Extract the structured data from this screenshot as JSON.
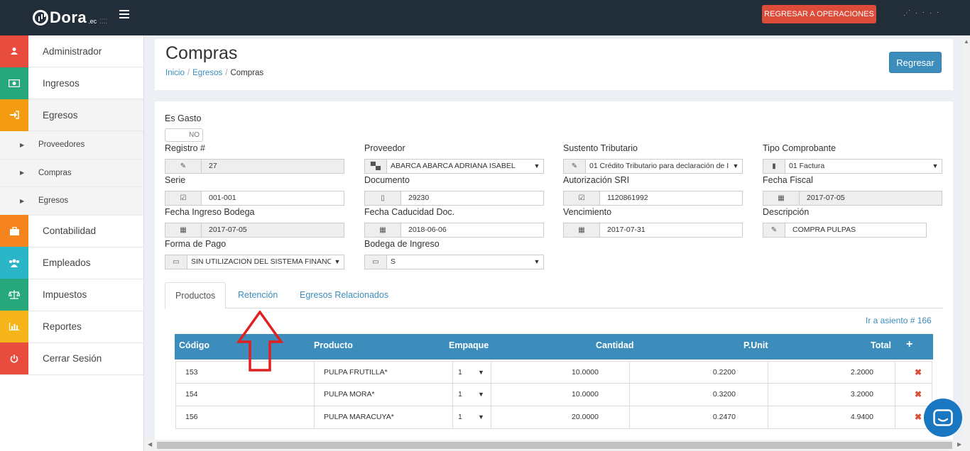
{
  "topbar": {
    "logo_text": "Dora",
    "logo_suffix": ".ec",
    "logo_suffix2": "⁚⁚⁚⁚",
    "ops_button": "REGRESAR A OPERACIONES",
    "user_text": "⋰ · ⋅ · ⋅"
  },
  "sidebar": {
    "items": [
      {
        "label": "Administrador",
        "color": "#e74c3c",
        "icon": "user-icon"
      },
      {
        "label": "Ingresos",
        "color": "#26a77c",
        "icon": "money-icon"
      },
      {
        "label": "Egresos",
        "color": "#f39c12",
        "icon": "sign-in-icon"
      }
    ],
    "subitems": [
      {
        "label": "Proveedores"
      },
      {
        "label": "Compras"
      },
      {
        "label": "Egresos"
      }
    ],
    "items2": [
      {
        "label": "Contabilidad",
        "color": "#f5841f",
        "icon": "briefcase-icon"
      },
      {
        "label": "Empleados",
        "color": "#2bb5c9",
        "icon": "users-icon"
      },
      {
        "label": "Impuestos",
        "color": "#26a77c",
        "icon": "balance-scale-icon"
      },
      {
        "label": "Reportes",
        "color": "#f5b51b",
        "icon": "bar-chart-icon"
      },
      {
        "label": "Cerrar Sesión",
        "color": "#e74c3c",
        "icon": "power-icon"
      }
    ]
  },
  "header": {
    "title": "Compras",
    "breadcrumb": [
      "Inicio",
      "Egresos",
      "Compras"
    ],
    "back_button": "Regresar"
  },
  "form": {
    "es_gasto_label": "Es Gasto",
    "es_gasto_value": "NO",
    "registro_label": "Registro #",
    "registro_value": "27",
    "proveedor_label": "Proveedor",
    "proveedor_value": "ABARCA ABARCA ADRIANA ISABEL",
    "sustento_label": "Sustento Tributario",
    "sustento_value": "01 Crédito Tributario para declaración de I",
    "tipo_label": "Tipo Comprobante",
    "tipo_value": "01 Factura",
    "serie_label": "Serie",
    "serie_value": "001-001",
    "documento_label": "Documento",
    "documento_value": "29230",
    "autorizacion_label": "Autorización SRI",
    "autorizacion_value": "1120861992",
    "fecha_fiscal_label": "Fecha Fiscal",
    "fecha_fiscal_value": "2017-07-05",
    "fecha_bodega_label": "Fecha Ingreso Bodega",
    "fecha_bodega_value": "2017-07-05",
    "fecha_caducidad_label": "Fecha Caducidad Doc.",
    "fecha_caducidad_value": "2018-06-06",
    "vencimiento_label": "Vencimiento",
    "vencimiento_value": "2017-07-31",
    "descripcion_label": "Descripción",
    "descripcion_value": "COMPRA PULPAS",
    "forma_pago_label": "Forma de Pago",
    "forma_pago_value": "SIN UTILIZACION DEL SISTEMA FINANCI",
    "bodega_label": "Bodega de Ingreso",
    "bodega_value": "S"
  },
  "tabs": [
    "Productos",
    "Retención",
    "Egresos Relacionados"
  ],
  "asiento_link": "Ir a asiento # 166",
  "table": {
    "headers": [
      "Código",
      "Producto",
      "Empaque",
      "Cantidad",
      "P.Unit",
      "Total"
    ],
    "rows": [
      {
        "codigo": "153",
        "producto": "PULPA FRUTILLA*",
        "empaque": "1",
        "cantidad": "10.0000",
        "punit": "0.2200",
        "total": "2.2000"
      },
      {
        "codigo": "154",
        "producto": "PULPA MORA*",
        "empaque": "1",
        "cantidad": "10.0000",
        "punit": "0.3200",
        "total": "3.2000"
      },
      {
        "codigo": "156",
        "producto": "PULPA MARACUYA*",
        "empaque": "1",
        "cantidad": "20.0000",
        "punit": "0.2470",
        "total": "4.9400"
      }
    ]
  },
  "colors": {
    "accent": "#3c8dbc",
    "danger": "#dd4b39",
    "topbar": "#222d3a",
    "annotation": "#e02020"
  }
}
